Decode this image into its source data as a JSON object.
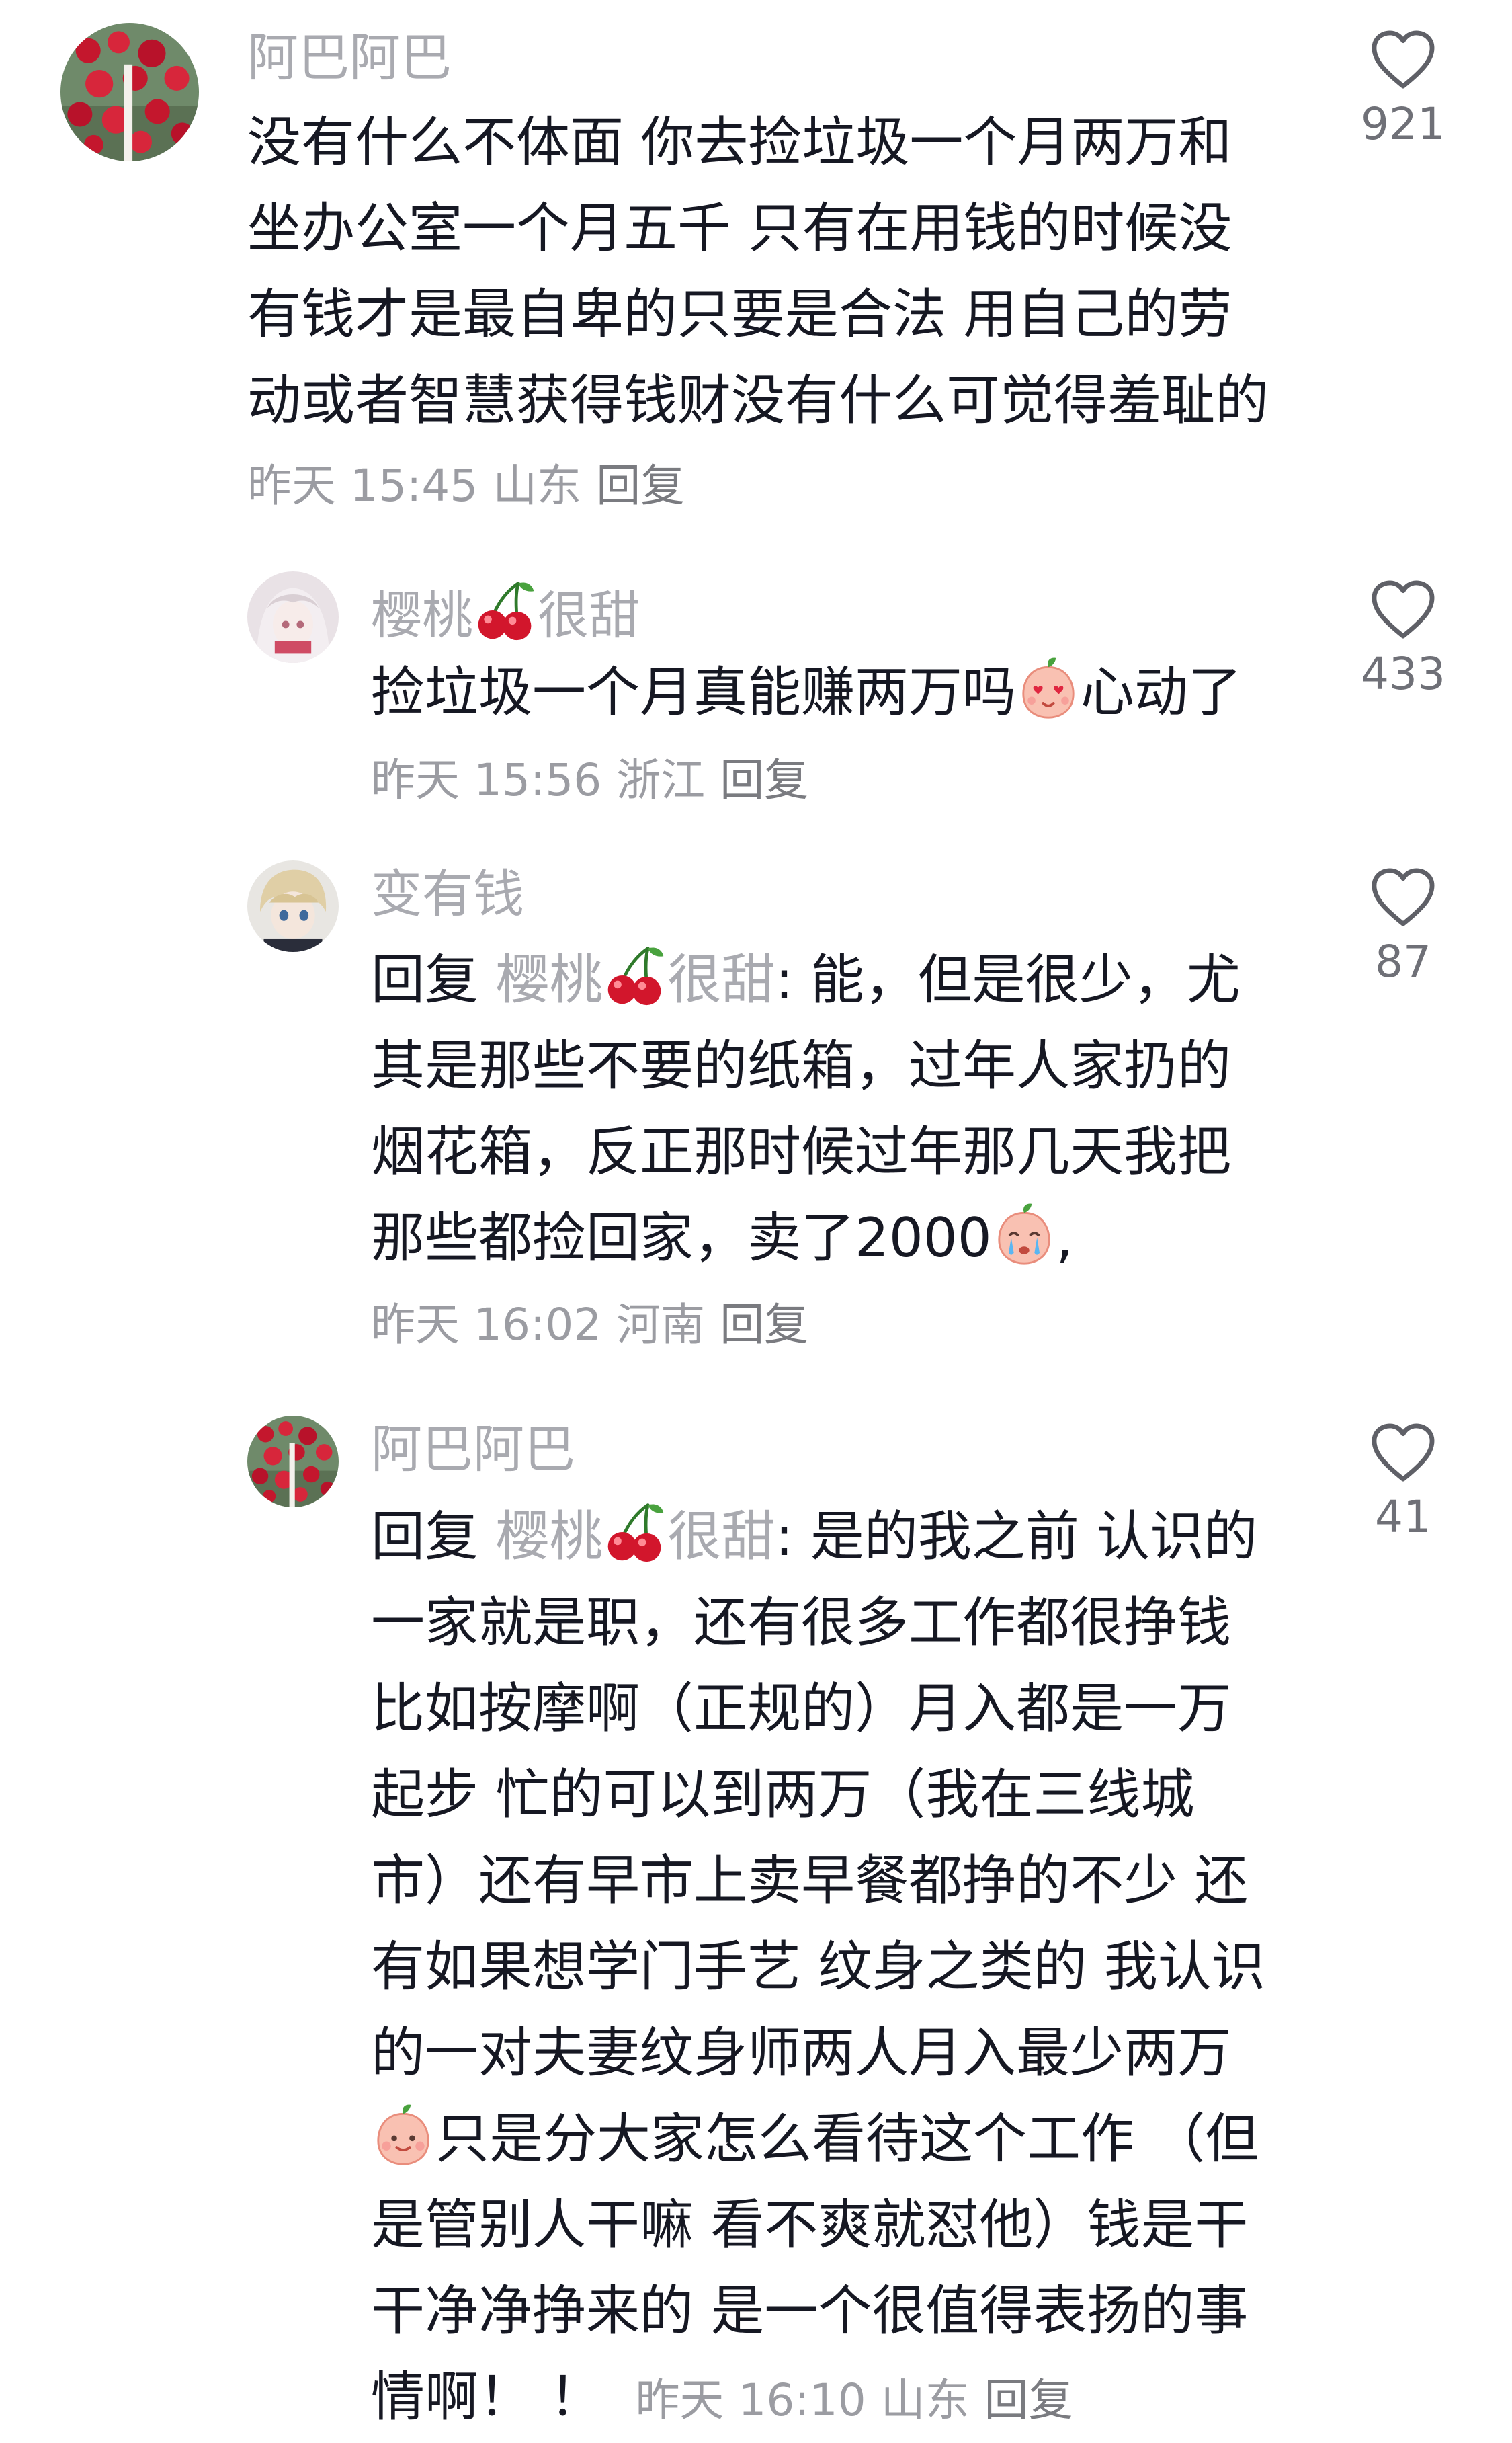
{
  "comments": [
    {
      "username": "阿巴阿巴",
      "lines": [
        "没有什么不体面 你去捡垃圾一个月两万和",
        "坐办公室一个月五千 只有在用钱的时候没",
        "有钱才是最自卑的只要是合法 用自己的劳",
        "动或者智慧获得钱财没有什么可觉得羞耻的"
      ],
      "time": "昨天 15:45",
      "location": "山东",
      "reply_label": "回复",
      "likes": "921"
    },
    {
      "username_part1": "樱桃",
      "username_part2": "很甜",
      "line1_text": "捡垃圾一个月真能赚两万吗",
      "line1_suffix": "心动了",
      "time": "昨天 15:56",
      "location": "浙江",
      "reply_label": "回复",
      "likes": "433"
    },
    {
      "username": "变有钱",
      "reply_prefix": "回复",
      "reply_to_part1": "樱桃",
      "reply_to_part2": "很甜",
      "line1_rest": ": 能，但是很少，尤",
      "lines": [
        "其是那些不要的纸箱，过年人家扔的",
        "烟花箱，反正那时候过年那几天我把"
      ],
      "last_line": "那些都捡回家，卖了2000",
      "last_line_suffix": ",",
      "time": "昨天 16:02",
      "location": "河南",
      "reply_label": "回复",
      "likes": "87"
    },
    {
      "username": "阿巴阿巴",
      "reply_prefix": "回复",
      "reply_to_part1": "樱桃",
      "reply_to_part2": "很甜",
      "line1_rest": ": 是的我之前 认识的",
      "lines": [
        "一家就是职，还有很多工作都很挣钱",
        "比如按摩啊（正规的）月入都是一万",
        "起步 忙的可以到两万（我在三线城",
        "市）还有早市上卖早餐都挣的不少 还",
        "有如果想学门手艺 纹身之类的 我认识",
        "的一对夫妻纹身师两人月入最少两万"
      ],
      "emoji_line": "只是分大家怎么看待这个工作 （但",
      "lines_after": [
        "是管别人干嘛 看不爽就怼他）钱是干",
        "干净净挣来的 是一个很值得表扬的事"
      ],
      "final_line": "情啊！ ！",
      "time": "昨天 16:10",
      "location": "山东",
      "reply_label": "回复",
      "likes": "41"
    }
  ],
  "icons": {
    "like": "heart-outline-icon",
    "cherry": "cherry-emoji",
    "peach_heart_eyes": "peach-heart-eyes-emoji",
    "peach_crying": "peach-crying-emoji",
    "peach_smile": "peach-smile-emoji"
  },
  "colors": {
    "text": "#161823",
    "username": "#a9aab0",
    "meta": "#9b9ca2",
    "like_count": "#6f7077",
    "cherry": "#d2162c",
    "peach": "#f6a89a"
  }
}
